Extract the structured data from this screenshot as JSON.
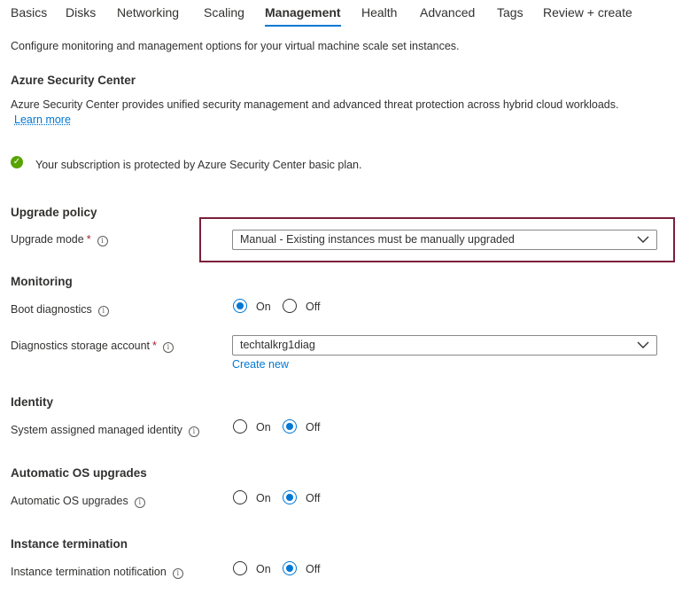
{
  "tabs": [
    {
      "label": "Basics"
    },
    {
      "label": "Disks"
    },
    {
      "label": "Networking"
    },
    {
      "label": "Scaling"
    },
    {
      "label": "Management"
    },
    {
      "label": "Health"
    },
    {
      "label": "Advanced"
    },
    {
      "label": "Tags"
    },
    {
      "label": "Review + create"
    }
  ],
  "active_tab": "Management",
  "intro": "Configure monitoring and management options for your virtual machine scale set instances.",
  "security_center": {
    "heading": "Azure Security Center",
    "description": "Azure Security Center provides unified security management and advanced threat protection across hybrid cloud workloads.",
    "learn_more": "Learn more",
    "status_text": "Your subscription is protected by Azure Security Center basic plan.",
    "status_icon": "checkmark-circle-icon"
  },
  "upgrade_policy": {
    "heading": "Upgrade policy",
    "mode_label": "Upgrade mode",
    "required_mark": "*",
    "mode_value": "Manual - Existing instances must be manually upgraded"
  },
  "monitoring": {
    "heading": "Monitoring",
    "boot_label": "Boot diagnostics",
    "boot_value": "On",
    "storage_label": "Diagnostics storage account",
    "required_mark": "*",
    "storage_value": "techtalkrg1diag",
    "create_new": "Create new"
  },
  "identity": {
    "heading": "Identity",
    "label": "System assigned managed identity",
    "value": "Off"
  },
  "auto_os": {
    "heading": "Automatic OS upgrades",
    "label": "Automatic OS upgrades",
    "value": "Off"
  },
  "termination": {
    "heading": "Instance termination",
    "label": "Instance termination notification",
    "value": "Off"
  },
  "radio_labels": {
    "on": "On",
    "off": "Off"
  },
  "info_glyph": "i",
  "colors": {
    "accent": "#0078d4",
    "success": "#57a300",
    "required": "#a4262c",
    "highlight_border": "#7b1f3a"
  }
}
